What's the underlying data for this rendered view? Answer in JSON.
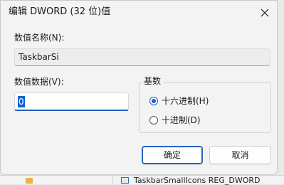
{
  "dialog": {
    "title": "编辑 DWORD (32 位)值",
    "value_name_label": "数值名称(N):",
    "value_name": "TaskbarSi",
    "value_data_label": "数值数据(V):",
    "value_data": "0",
    "base": {
      "title": "基数",
      "options": [
        {
          "label": "十六进制(H)",
          "selected": true
        },
        {
          "label": "十进制(D)",
          "selected": false
        }
      ]
    },
    "buttons": {
      "ok": "确定",
      "cancel": "取消"
    }
  },
  "background": {
    "row_text": "TaskbarSmallIcons    REG_DWORD"
  },
  "colors": {
    "accent": "#1f5fbf",
    "selection": "#0a64d6",
    "dialog_bg": "#f3f3f3"
  },
  "icons": [
    "close-icon",
    "folder-icon",
    "registry-value-icon"
  ]
}
